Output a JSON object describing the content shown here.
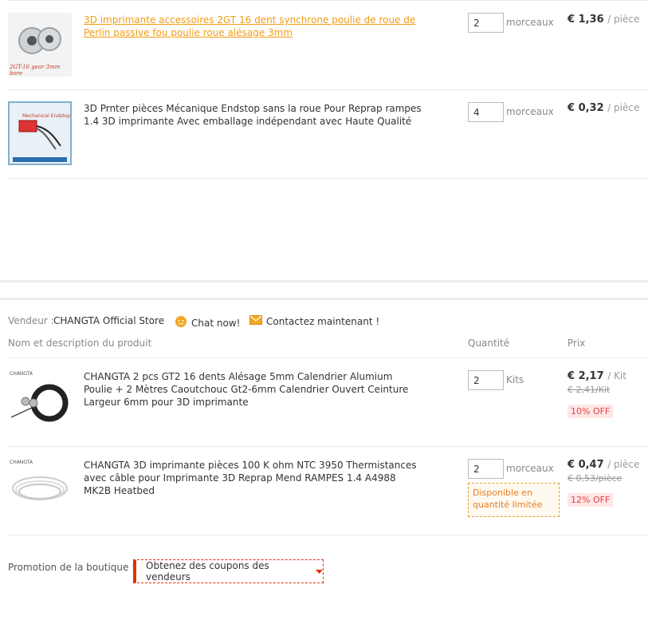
{
  "cart1": {
    "items": [
      {
        "title": "3D imprimante accessoires 2GT 16 dent synchrone poulie de roue de Perlin passive fou poulie roue alésage 3mm",
        "image_caption": "2GT-16 gear 3mm bore",
        "qty": "2",
        "unit": "morceaux",
        "price": "€ 1,36",
        "per": "/ pièce"
      },
      {
        "title": "3D Prnter pièces Mécanique Endstop sans la roue Pour Reprap rampes 1.4 3D imprimante Avec emballage indépendant avec Haute Qualité",
        "image_caption": "Mechanical Endstop",
        "qty": "4",
        "unit": "morceaux",
        "price": "€ 0,32",
        "per": "/ pièce"
      }
    ]
  },
  "store": {
    "vendor_label": "Vendeur :",
    "vendor_name": "CHANGTA Official Store",
    "chat_label": "Chat now!",
    "contact_label": "Contactez maintenant !",
    "colors": {
      "chat_icon": "#f5a623",
      "mail_icon": "#f5a623"
    }
  },
  "headers": {
    "product": "Nom et description du produit",
    "quantity": "Quantité",
    "price": "Prix"
  },
  "cart2": {
    "items": [
      {
        "title": "CHANGTA 2 pcs GT2 16 dents Alésage 5mm Calendrier Alumium Poulie + 2 Mètres Caoutchouc Gt2-6mm Calendrier Ouvert Ceinture Largeur 6mm pour 3D imprimante",
        "brand_mark": "CHANGTA",
        "qty": "2",
        "unit": "Kits",
        "price": "€ 2,17",
        "per": "/ Kit",
        "old_price": "€ 2,41/Kit",
        "discount": "10% OFF"
      },
      {
        "title": "CHANGTA 3D imprimante pièces 100 K ohm NTC 3950 Thermistances avec câble pour Imprimante 3D Reprap Mend RAMPES 1.4 A4988 MK2B Heatbed",
        "brand_mark": "CHANGTA",
        "qty": "2",
        "unit": "morceaux",
        "price": "€ 0,47",
        "per": "/ pièce",
        "old_price": "€ 0,53/pièce",
        "discount": "12% OFF",
        "availability": "Disponible en quantité limitée"
      }
    ]
  },
  "promo": {
    "label": "Promotion de la boutique :",
    "coupon_button": "Obtenez des coupons des vendeurs",
    "accent": "#e62e04"
  }
}
